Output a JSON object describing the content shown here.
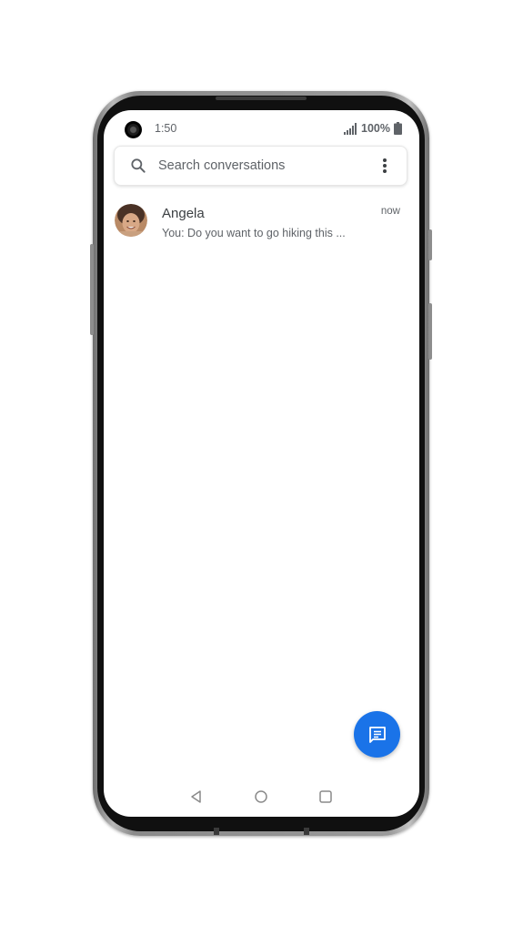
{
  "status_bar": {
    "time": "1:50",
    "battery": "100%",
    "icons": [
      "front-camera",
      "signal-icon",
      "battery-icon"
    ]
  },
  "search": {
    "placeholder": "Search conversations",
    "icons": [
      "search-icon",
      "more-vert-icon"
    ]
  },
  "conversations": [
    {
      "name": "Angela",
      "time": "now",
      "snippet": "You: Do you want to go hiking this ..."
    }
  ],
  "fab": {
    "icon": "start-chat-icon",
    "color": "#1a73e8"
  },
  "nav": {
    "icons": [
      "back-icon",
      "home-icon",
      "recents-icon"
    ]
  },
  "colors": {
    "accent": "#1a73e8",
    "text_primary": "#3c4043",
    "text_secondary": "#5f6368"
  }
}
